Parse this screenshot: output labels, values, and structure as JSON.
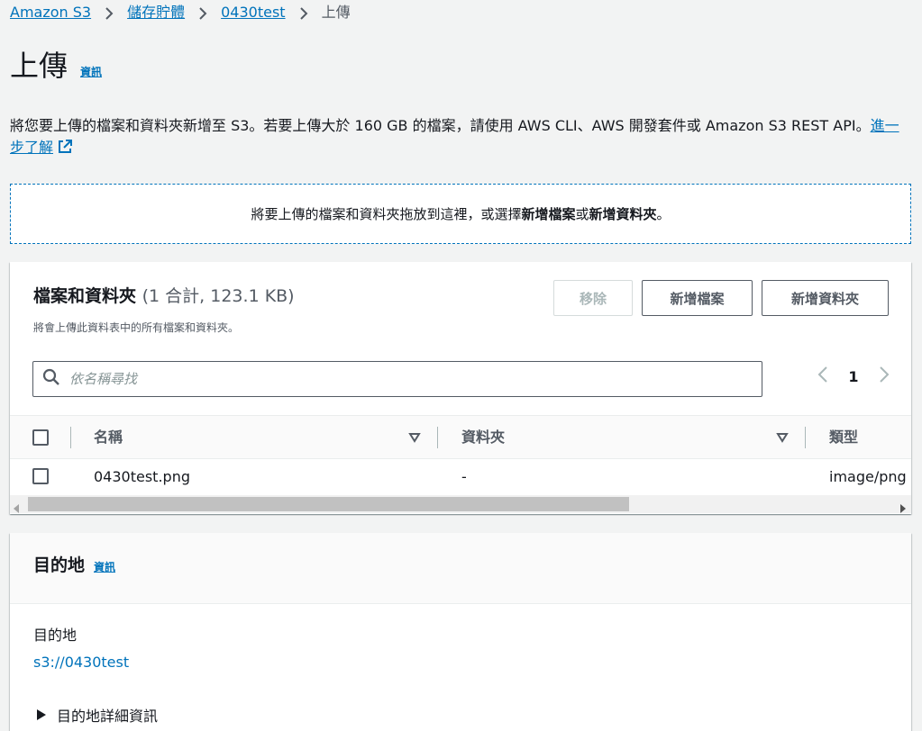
{
  "breadcrumb": {
    "items": [
      "Amazon S3",
      "儲存貯體",
      "0430test"
    ],
    "current": "上傳"
  },
  "page": {
    "title": "上傳",
    "info": "資訊",
    "description": "將您要上傳的檔案和資料夾新增至 S3。若要上傳大於 160 GB 的檔案，請使用 AWS CLI、AWS 開發套件或 Amazon S3 REST API。",
    "learn_more": "進一步了解"
  },
  "dropzone": {
    "text_prefix": "將要上傳的檔案和資料夾拖放到這裡，或選擇",
    "add_files": "新增檔案",
    "or": "或",
    "add_folder": "新增資料夾",
    "suffix": "。"
  },
  "files_panel": {
    "title": "檔案和資料夾",
    "count": "(1 合計, 123.1 KB)",
    "subtitle": "將會上傳此資料表中的所有檔案和資料夾。",
    "remove_label": "移除",
    "add_files_label": "新增檔案",
    "add_folder_label": "新增資料夾",
    "search_placeholder": "依名稱尋找",
    "page_number": "1",
    "columns": [
      "名稱",
      "資料夾",
      "類型"
    ],
    "rows": [
      {
        "name": "0430test.png",
        "folder": "-",
        "type": "image/png"
      }
    ]
  },
  "destination": {
    "title": "目的地",
    "info": "資訊",
    "label": "目的地",
    "value": "s3://0430test",
    "details_label": "目的地詳細資訊"
  },
  "colors": {
    "link": "#0073bb",
    "background": "#f2f3f3",
    "text": "#16191f",
    "muted": "#545b64"
  }
}
